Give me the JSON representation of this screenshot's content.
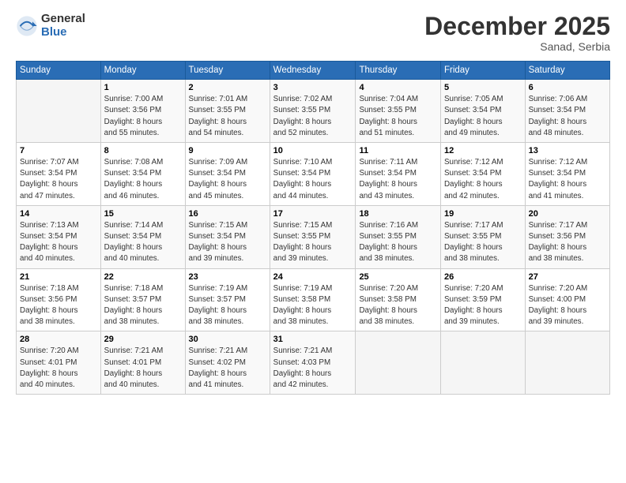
{
  "logo": {
    "general": "General",
    "blue": "Blue"
  },
  "title": "December 2025",
  "location": "Sanad, Serbia",
  "days_header": [
    "Sunday",
    "Monday",
    "Tuesday",
    "Wednesday",
    "Thursday",
    "Friday",
    "Saturday"
  ],
  "weeks": [
    [
      {
        "day": "",
        "info": ""
      },
      {
        "day": "1",
        "info": "Sunrise: 7:00 AM\nSunset: 3:56 PM\nDaylight: 8 hours\nand 55 minutes."
      },
      {
        "day": "2",
        "info": "Sunrise: 7:01 AM\nSunset: 3:55 PM\nDaylight: 8 hours\nand 54 minutes."
      },
      {
        "day": "3",
        "info": "Sunrise: 7:02 AM\nSunset: 3:55 PM\nDaylight: 8 hours\nand 52 minutes."
      },
      {
        "day": "4",
        "info": "Sunrise: 7:04 AM\nSunset: 3:55 PM\nDaylight: 8 hours\nand 51 minutes."
      },
      {
        "day": "5",
        "info": "Sunrise: 7:05 AM\nSunset: 3:54 PM\nDaylight: 8 hours\nand 49 minutes."
      },
      {
        "day": "6",
        "info": "Sunrise: 7:06 AM\nSunset: 3:54 PM\nDaylight: 8 hours\nand 48 minutes."
      }
    ],
    [
      {
        "day": "7",
        "info": "Sunrise: 7:07 AM\nSunset: 3:54 PM\nDaylight: 8 hours\nand 47 minutes."
      },
      {
        "day": "8",
        "info": "Sunrise: 7:08 AM\nSunset: 3:54 PM\nDaylight: 8 hours\nand 46 minutes."
      },
      {
        "day": "9",
        "info": "Sunrise: 7:09 AM\nSunset: 3:54 PM\nDaylight: 8 hours\nand 45 minutes."
      },
      {
        "day": "10",
        "info": "Sunrise: 7:10 AM\nSunset: 3:54 PM\nDaylight: 8 hours\nand 44 minutes."
      },
      {
        "day": "11",
        "info": "Sunrise: 7:11 AM\nSunset: 3:54 PM\nDaylight: 8 hours\nand 43 minutes."
      },
      {
        "day": "12",
        "info": "Sunrise: 7:12 AM\nSunset: 3:54 PM\nDaylight: 8 hours\nand 42 minutes."
      },
      {
        "day": "13",
        "info": "Sunrise: 7:12 AM\nSunset: 3:54 PM\nDaylight: 8 hours\nand 41 minutes."
      }
    ],
    [
      {
        "day": "14",
        "info": "Sunrise: 7:13 AM\nSunset: 3:54 PM\nDaylight: 8 hours\nand 40 minutes."
      },
      {
        "day": "15",
        "info": "Sunrise: 7:14 AM\nSunset: 3:54 PM\nDaylight: 8 hours\nand 40 minutes."
      },
      {
        "day": "16",
        "info": "Sunrise: 7:15 AM\nSunset: 3:54 PM\nDaylight: 8 hours\nand 39 minutes."
      },
      {
        "day": "17",
        "info": "Sunrise: 7:15 AM\nSunset: 3:55 PM\nDaylight: 8 hours\nand 39 minutes."
      },
      {
        "day": "18",
        "info": "Sunrise: 7:16 AM\nSunset: 3:55 PM\nDaylight: 8 hours\nand 38 minutes."
      },
      {
        "day": "19",
        "info": "Sunrise: 7:17 AM\nSunset: 3:55 PM\nDaylight: 8 hours\nand 38 minutes."
      },
      {
        "day": "20",
        "info": "Sunrise: 7:17 AM\nSunset: 3:56 PM\nDaylight: 8 hours\nand 38 minutes."
      }
    ],
    [
      {
        "day": "21",
        "info": "Sunrise: 7:18 AM\nSunset: 3:56 PM\nDaylight: 8 hours\nand 38 minutes."
      },
      {
        "day": "22",
        "info": "Sunrise: 7:18 AM\nSunset: 3:57 PM\nDaylight: 8 hours\nand 38 minutes."
      },
      {
        "day": "23",
        "info": "Sunrise: 7:19 AM\nSunset: 3:57 PM\nDaylight: 8 hours\nand 38 minutes."
      },
      {
        "day": "24",
        "info": "Sunrise: 7:19 AM\nSunset: 3:58 PM\nDaylight: 8 hours\nand 38 minutes."
      },
      {
        "day": "25",
        "info": "Sunrise: 7:20 AM\nSunset: 3:58 PM\nDaylight: 8 hours\nand 38 minutes."
      },
      {
        "day": "26",
        "info": "Sunrise: 7:20 AM\nSunset: 3:59 PM\nDaylight: 8 hours\nand 39 minutes."
      },
      {
        "day": "27",
        "info": "Sunrise: 7:20 AM\nSunset: 4:00 PM\nDaylight: 8 hours\nand 39 minutes."
      }
    ],
    [
      {
        "day": "28",
        "info": "Sunrise: 7:20 AM\nSunset: 4:01 PM\nDaylight: 8 hours\nand 40 minutes."
      },
      {
        "day": "29",
        "info": "Sunrise: 7:21 AM\nSunset: 4:01 PM\nDaylight: 8 hours\nand 40 minutes."
      },
      {
        "day": "30",
        "info": "Sunrise: 7:21 AM\nSunset: 4:02 PM\nDaylight: 8 hours\nand 41 minutes."
      },
      {
        "day": "31",
        "info": "Sunrise: 7:21 AM\nSunset: 4:03 PM\nDaylight: 8 hours\nand 42 minutes."
      },
      {
        "day": "",
        "info": ""
      },
      {
        "day": "",
        "info": ""
      },
      {
        "day": "",
        "info": ""
      }
    ]
  ]
}
